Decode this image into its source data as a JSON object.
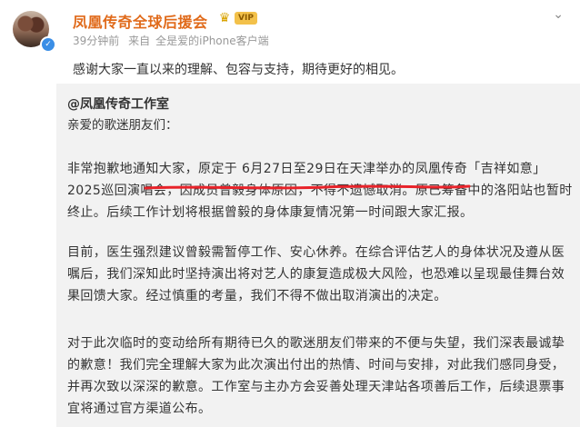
{
  "post": {
    "author_name": "凤凰传奇全球后援会",
    "time_ago": "39分钟前",
    "source_prefix": "来自",
    "source_app": "全是爱的iPhone客户端",
    "main_text": "感谢大家一直以来的理解、包容与支持，期待更好的相见。"
  },
  "repost": {
    "author": "@凤凰传奇工作室",
    "greeting": "亲爱的歌迷朋友们：",
    "paragraphs": [
      "非常抱歉地通知大家，原定于 6月27日至29日在天津举办的凤凰传奇「吉祥如意」2025巡回演唱会，因成员曾毅身体原因，不得不遗憾取消。原已筹备中的洛阳站也暂时终止。后续工作计划将根据曾毅的身体康复情况第一时间跟大家汇报。",
      "目前，医生强烈建议曾毅需暂停工作、安心休养。在综合评估艺人的身体状况及遵从医嘱后，我们深知此时坚持演出将对艺人的康复造成极大风险，也恐难以呈现最佳舞台效果回馈大家。经过慎重的考量，我们不得不做出取消演出的决定。",
      "对于此次临时的变动给所有期待已久的歌迷朋友们带来的不便与失望，我们深表最诚挚的歉意！我们完全理解大家为此次演出付出的热情、时间与安排，对此我们感同身受，并再次致以深深的歉意。工作室与主办方会妥善处理天津站各项善后工作，后续退票事宜将通过官方渠道公布。"
    ]
  },
  "icons": {
    "verified": "verified-badge-icon",
    "crown": "crown-icon",
    "more": "chevron-down-icon"
  },
  "colors": {
    "author": "#e06a1a",
    "annotation": "#e8232a",
    "repost_bg": "#f2f2f2"
  }
}
